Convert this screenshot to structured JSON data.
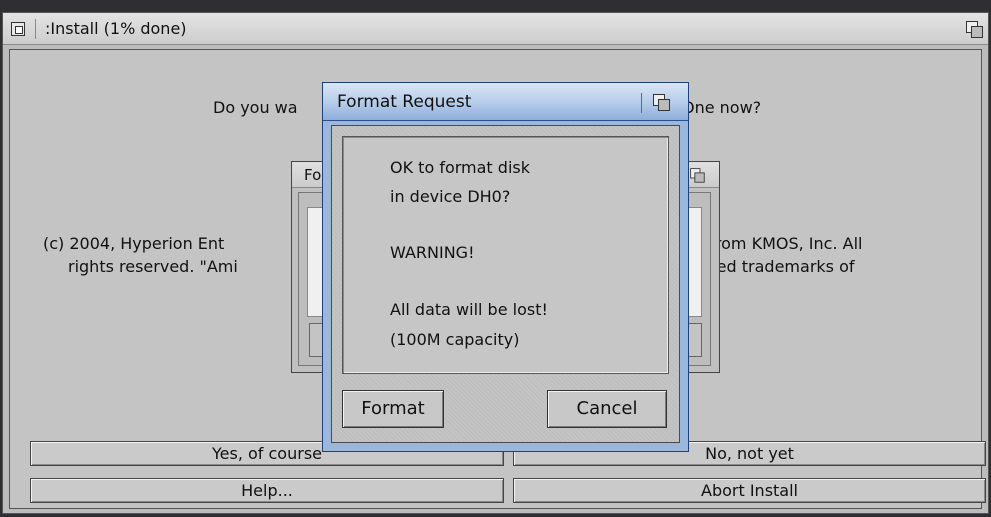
{
  "main_window": {
    "title": ":Install (1% done)",
    "question_left": "Do you wa",
    "question_right": "One now?",
    "copyright_left_1": "(c) 2004, Hyperion Ent",
    "copyright_left_2": "rights reserved. \"Ami",
    "copyright_right_1": "se from KMOS, Inc. All",
    "copyright_right_2": "stered trademarks of",
    "buttons": {
      "yes": "Yes, of course",
      "no": "No, not yet",
      "help": "Help...",
      "abort": "Abort Install"
    }
  },
  "sub_window": {
    "title_fragment": "Fo"
  },
  "dialog": {
    "title": "Format Request",
    "lines": [
      "OK to format disk",
      "in device DH0?",
      "WARNING!",
      "All data will be lost!",
      "(100M capacity)"
    ],
    "format_button": "Format",
    "cancel_button": "Cancel"
  }
}
